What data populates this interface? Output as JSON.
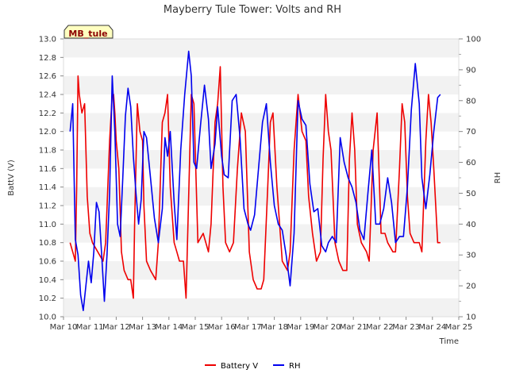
{
  "chart_data": {
    "type": "line",
    "title": "Mayberry Tule Tower: Volts and RH",
    "badge": "MB_tule",
    "xlabel": "Time",
    "ylabel_left": "BattV (V)",
    "ylabel_right": "RH",
    "ylim_left": [
      10.0,
      13.0
    ],
    "ylim_right": [
      10,
      100
    ],
    "xlim": [
      10,
      25
    ],
    "left_ticks": [
      "10.0",
      "10.2",
      "10.4",
      "10.6",
      "10.8",
      "11.0",
      "11.2",
      "11.4",
      "11.6",
      "11.8",
      "12.0",
      "12.2",
      "12.4",
      "12.6",
      "12.8",
      "13.0"
    ],
    "right_ticks": [
      "10",
      "20",
      "30",
      "40",
      "50",
      "60",
      "70",
      "80",
      "90",
      "100"
    ],
    "x_ticks": [
      {
        "v": 10,
        "label": "Mar 10"
      },
      {
        "v": 11,
        "label": "Mar 11"
      },
      {
        "v": 12,
        "label": "Mar 12"
      },
      {
        "v": 13,
        "label": "Mar 13"
      },
      {
        "v": 14,
        "label": "Mar 14"
      },
      {
        "v": 15,
        "label": "Mar 15"
      },
      {
        "v": 16,
        "label": "Mar 16"
      },
      {
        "v": 17,
        "label": "Mar 17"
      },
      {
        "v": 18,
        "label": "Mar 18"
      },
      {
        "v": 19,
        "label": "Mar 19"
      },
      {
        "v": 20,
        "label": "Mar 20"
      },
      {
        "v": 21,
        "label": "Mar 21"
      },
      {
        "v": 22,
        "label": "Mar 22"
      },
      {
        "v": 23,
        "label": "Mar 23"
      },
      {
        "v": 24,
        "label": "Mar 24"
      },
      {
        "v": 25,
        "label": "Mar 25"
      }
    ],
    "grid": "horizontal bands",
    "legend_position": "bottom-center",
    "series": [
      {
        "name": "Battery V",
        "axis": "left",
        "color": "#ee0000",
        "x": [
          10.25,
          10.35,
          10.45,
          10.5,
          10.55,
          10.6,
          10.7,
          10.8,
          10.9,
          11.0,
          11.05,
          11.1,
          11.3,
          11.5,
          11.6,
          11.75,
          11.85,
          11.9,
          11.95,
          12.0,
          12.1,
          12.2,
          12.3,
          12.45,
          12.55,
          12.65,
          12.7,
          12.8,
          12.9,
          13.0,
          13.05,
          13.15,
          13.3,
          13.5,
          13.6,
          13.75,
          13.85,
          13.95,
          14.05,
          14.2,
          14.3,
          14.4,
          14.55,
          14.65,
          14.75,
          14.85,
          14.95,
          15.1,
          15.3,
          15.5,
          15.6,
          15.75,
          15.85,
          15.95,
          16.05,
          16.15,
          16.3,
          16.45,
          16.6,
          16.75,
          16.9,
          17.05,
          17.2,
          17.35,
          17.5,
          17.6,
          17.75,
          17.85,
          17.95,
          18.1,
          18.3,
          18.5,
          18.6,
          18.75,
          18.9,
          19.05,
          19.2,
          19.3,
          19.45,
          19.6,
          19.75,
          19.85,
          19.95,
          20.05,
          20.15,
          20.3,
          20.45,
          20.6,
          20.75,
          20.85,
          20.95,
          21.05,
          21.15,
          21.3,
          21.5,
          21.6,
          21.75,
          21.9,
          22.05,
          22.2,
          22.3,
          22.5,
          22.6,
          22.75,
          22.85,
          22.95,
          23.05,
          23.15,
          23.3,
          23.5,
          23.6,
          23.75,
          23.85,
          23.95,
          24.05,
          24.2,
          24.3
        ],
        "y": [
          10.8,
          10.7,
          10.6,
          11.4,
          12.6,
          12.4,
          12.2,
          12.3,
          11.3,
          10.9,
          10.85,
          10.8,
          10.7,
          10.6,
          10.8,
          11.9,
          12.4,
          12.4,
          12.2,
          11.9,
          11.6,
          10.7,
          10.5,
          10.4,
          10.4,
          10.2,
          11.0,
          12.3,
          12.0,
          11.9,
          11.2,
          10.6,
          10.5,
          10.4,
          10.8,
          12.1,
          12.2,
          12.4,
          11.4,
          10.8,
          10.7,
          10.6,
          10.6,
          10.2,
          11.3,
          12.4,
          12.3,
          10.8,
          10.9,
          10.7,
          11.0,
          12.1,
          12.3,
          12.7,
          11.4,
          10.8,
          10.7,
          10.8,
          11.6,
          12.2,
          12.0,
          10.7,
          10.4,
          10.3,
          10.3,
          10.4,
          11.4,
          12.1,
          12.2,
          11.4,
          10.6,
          10.5,
          10.7,
          11.8,
          12.4,
          12.0,
          11.9,
          11.3,
          10.9,
          10.6,
          10.7,
          11.7,
          12.4,
          12.0,
          11.8,
          10.8,
          10.6,
          10.5,
          10.5,
          11.7,
          12.2,
          11.8,
          11.0,
          10.8,
          10.7,
          10.6,
          11.8,
          12.2,
          10.9,
          10.9,
          10.8,
          10.7,
          10.7,
          11.6,
          12.3,
          12.1,
          11.3,
          10.9,
          10.8,
          10.8,
          10.7,
          11.9,
          12.4,
          12.1,
          11.6,
          10.8,
          10.8
        ]
      },
      {
        "name": "RH",
        "axis": "right",
        "color": "#0000ee",
        "x": [
          10.25,
          10.35,
          10.45,
          10.55,
          10.65,
          10.75,
          10.85,
          10.95,
          11.05,
          11.15,
          11.25,
          11.35,
          11.45,
          11.55,
          11.65,
          11.75,
          11.85,
          11.95,
          12.05,
          12.15,
          12.25,
          12.35,
          12.45,
          12.55,
          12.65,
          12.75,
          12.85,
          12.95,
          13.05,
          13.15,
          13.3,
          13.45,
          13.6,
          13.75,
          13.85,
          13.95,
          14.05,
          14.2,
          14.3,
          14.45,
          14.6,
          14.75,
          14.85,
          14.95,
          15.05,
          15.2,
          15.35,
          15.5,
          15.6,
          15.75,
          15.85,
          16.0,
          16.1,
          16.25,
          16.4,
          16.55,
          16.7,
          16.85,
          17.0,
          17.1,
          17.25,
          17.4,
          17.55,
          17.7,
          17.85,
          18.0,
          18.15,
          18.3,
          18.45,
          18.6,
          18.75,
          18.9,
          19.05,
          19.2,
          19.35,
          19.5,
          19.65,
          19.8,
          19.95,
          20.05,
          20.2,
          20.35,
          20.5,
          20.65,
          20.8,
          20.95,
          21.1,
          21.25,
          21.4,
          21.55,
          21.7,
          21.85,
          22.0,
          22.15,
          22.3,
          22.45,
          22.6,
          22.75,
          22.9,
          23.05,
          23.2,
          23.35,
          23.5,
          23.6,
          23.75,
          23.9,
          24.05,
          24.2,
          24.3
        ],
        "y": [
          70,
          79,
          35,
          30,
          17,
          12,
          20,
          28,
          21,
          31,
          47,
          44,
          30,
          15,
          30,
          50,
          88,
          70,
          40,
          36,
          55,
          75,
          84,
          78,
          62,
          50,
          40,
          48,
          70,
          68,
          55,
          42,
          34,
          45,
          68,
          62,
          70,
          47,
          35,
          64,
          82,
          96,
          88,
          60,
          58,
          72,
          85,
          74,
          58,
          66,
          78,
          62,
          56,
          55,
          80,
          82,
          68,
          45,
          40,
          38,
          43,
          58,
          73,
          79,
          60,
          46,
          40,
          38,
          30,
          20,
          37,
          80,
          74,
          72,
          53,
          44,
          45,
          33,
          31,
          34,
          36,
          34,
          68,
          60,
          55,
          52,
          47,
          38,
          35,
          50,
          64,
          40,
          40,
          45,
          55,
          47,
          34,
          36,
          36,
          52,
          77,
          92,
          79,
          55,
          45,
          56,
          70,
          81,
          82
        ]
      }
    ]
  },
  "legend": {
    "items": [
      {
        "label": "Battery V",
        "color": "#ee0000"
      },
      {
        "label": "RH",
        "color": "#0000ee"
      }
    ]
  }
}
